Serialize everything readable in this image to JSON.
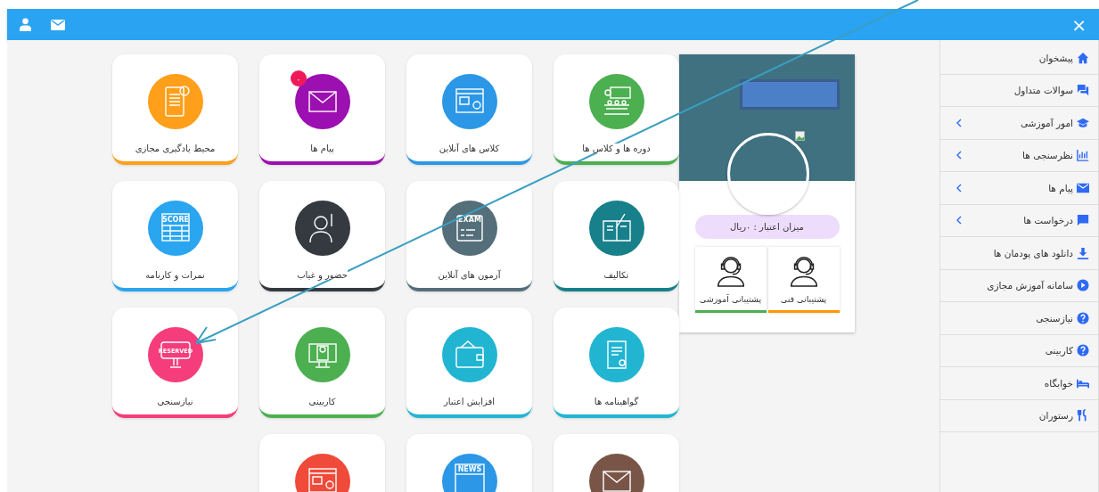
{
  "header": {
    "close": "×"
  },
  "tiles": [
    {
      "label": "دوره ها و کلاس ها",
      "color": "#4caf50"
    },
    {
      "label": "کلاس های آنلاین",
      "color": "#2b97e6"
    },
    {
      "label": "پیام ها",
      "color": "#9c0fb0",
      "badge": "۰"
    },
    {
      "label": "محیط یادگیری مجازی",
      "color": "#ff9f1a"
    },
    {
      "label": "تکالیف",
      "color": "#17808a"
    },
    {
      "label": "آزمون های آنلاین",
      "color": "#546e7a",
      "icon_text": "EXAM"
    },
    {
      "label": "حضور و غیاب",
      "color": "#343a40"
    },
    {
      "label": "نمرات و کارنامه",
      "color": "#2aa5f0",
      "icon_text": "SCORE"
    },
    {
      "label": "گواهینامه ها",
      "color": "#22b5d2"
    },
    {
      "label": "افزایش اعتبار",
      "color": "#22b5d2"
    },
    {
      "label": "کاربینی",
      "color": "#4caf50"
    },
    {
      "label": "نیازسنجی",
      "color": "#f53d7c",
      "icon_text": "RESERVED"
    },
    {
      "color": "#795548"
    },
    {
      "color": "#2b97e6",
      "icon_text": "NEWS"
    },
    {
      "color": "#f04a3a"
    }
  ],
  "profile": {
    "credit": "میزان اعتبار : ۰ریال",
    "support": [
      {
        "label": "پشتیبانی فنی",
        "color": "#ff9800"
      },
      {
        "label": "پشتیبانی آموزشی",
        "color": "#4caf50"
      }
    ]
  },
  "sidebar": [
    {
      "label": "پیشخوان",
      "submenu": false
    },
    {
      "label": "سوالات متداول",
      "submenu": false
    },
    {
      "label": "امور آموزشی",
      "submenu": true
    },
    {
      "label": "نظرسنجی ها",
      "submenu": true
    },
    {
      "label": "پیام ها",
      "submenu": true
    },
    {
      "label": "درخواست ها",
      "submenu": true
    },
    {
      "label": "دانلود های پودمان ها",
      "submenu": false
    },
    {
      "label": "سامانه آموزش مجازی",
      "submenu": false
    },
    {
      "label": "نیازسنجی",
      "submenu": false
    },
    {
      "label": "کاربینی",
      "submenu": false
    },
    {
      "label": "خوابگاه",
      "submenu": false
    },
    {
      "label": "رستوران",
      "submenu": false
    }
  ]
}
